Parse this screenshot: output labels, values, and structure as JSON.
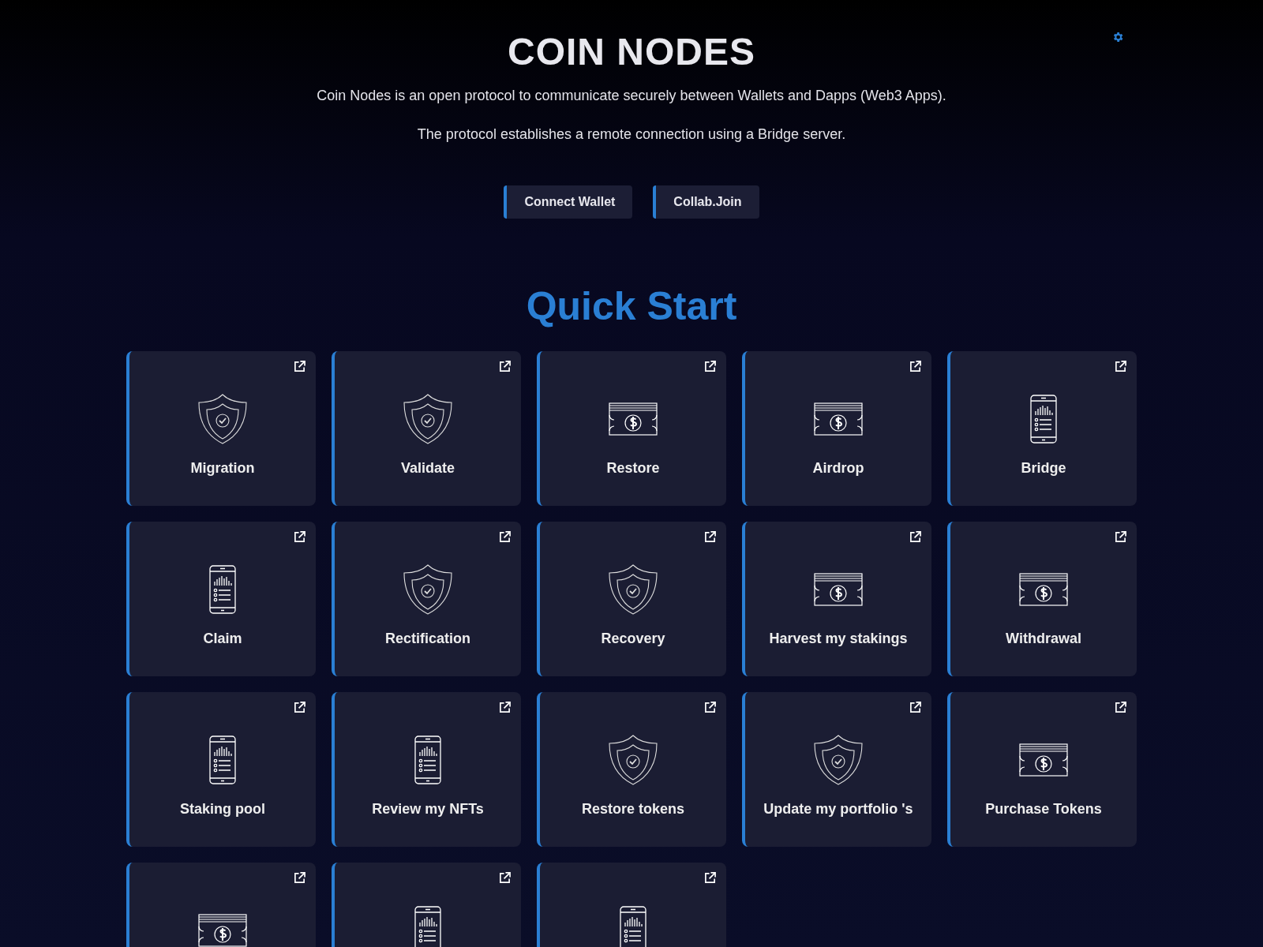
{
  "header": {
    "title": "COIN NODES",
    "lines": [
      "Coin Nodes is an open protocol to communicate securely between Wallets and Dapps (Web3 Apps).",
      "The protocol establishes a remote connection using a Bridge server."
    ],
    "buttons": [
      "Connect Wallet",
      "Collab.Join"
    ]
  },
  "quick_start": {
    "heading": "Quick Start",
    "cards": [
      {
        "label": "Migration",
        "kind": "shield"
      },
      {
        "label": "Validate",
        "kind": "shield"
      },
      {
        "label": "Restore",
        "kind": "money"
      },
      {
        "label": "Airdrop",
        "kind": "money"
      },
      {
        "label": "Bridge",
        "kind": "phone"
      },
      {
        "label": "Claim",
        "kind": "phone"
      },
      {
        "label": "Rectification",
        "kind": "shield"
      },
      {
        "label": "Recovery",
        "kind": "shield"
      },
      {
        "label": "Harvest my stakings",
        "kind": "money"
      },
      {
        "label": "Withdrawal",
        "kind": "money"
      },
      {
        "label": "Staking pool",
        "kind": "phone"
      },
      {
        "label": "Review my NFTs",
        "kind": "phone"
      },
      {
        "label": "Restore tokens",
        "kind": "shield"
      },
      {
        "label": "Update my portfolio 's",
        "kind": "shield"
      },
      {
        "label": "Purchase Tokens",
        "kind": "money"
      },
      {
        "kind": "money"
      },
      {
        "kind": "phone"
      },
      {
        "kind": "phone"
      }
    ]
  }
}
